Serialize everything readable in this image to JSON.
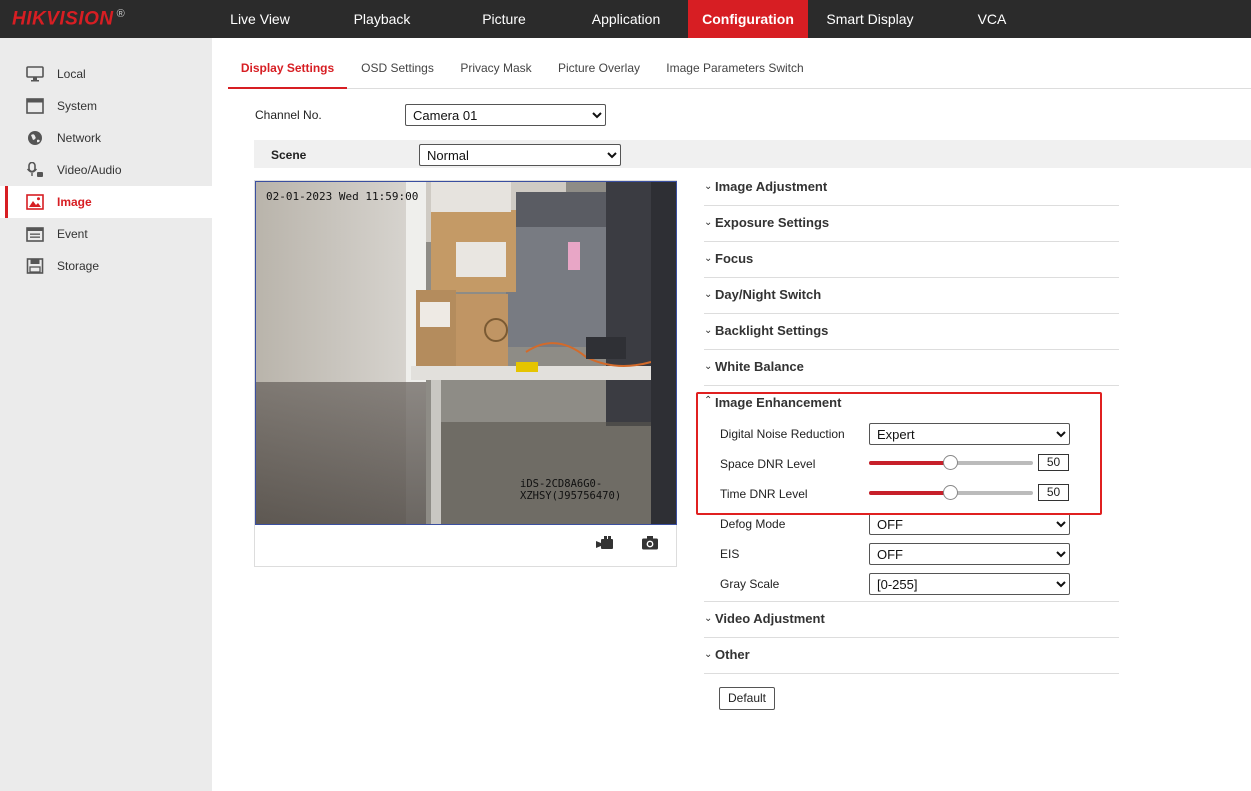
{
  "brand": {
    "name": "HIKVISION",
    "mark": "®",
    "accent": "#d71e23"
  },
  "nav": [
    "Live View",
    "Playback",
    "Picture",
    "Application",
    "Configuration",
    "Smart Display",
    "VCA"
  ],
  "sidebar": [
    {
      "label": "Local",
      "icon": "monitor-icon"
    },
    {
      "label": "System",
      "icon": "window-icon"
    },
    {
      "label": "Network",
      "icon": "globe-icon"
    },
    {
      "label": "Video/Audio",
      "icon": "microphone-icon"
    },
    {
      "label": "Image",
      "icon": "image-icon"
    },
    {
      "label": "Event",
      "icon": "calendar-icon"
    },
    {
      "label": "Storage",
      "icon": "disk-icon"
    }
  ],
  "tabs": [
    "Display Settings",
    "OSD Settings",
    "Privacy Mask",
    "Picture Overlay",
    "Image Parameters Switch"
  ],
  "channel": {
    "label": "Channel No.",
    "value": "Camera 01"
  },
  "scene": {
    "label": "Scene",
    "value": "Normal"
  },
  "video": {
    "timestamp": "02-01-2023 Wed 11:59:00",
    "camera_name": "iDS-2CD8A6G0-XZHSY(J95756470)"
  },
  "sections_top": [
    "Image Adjustment",
    "Exposure Settings",
    "Focus",
    "Day/Night Switch",
    "Backlight Settings",
    "White Balance"
  ],
  "enhancement": {
    "title": "Image Enhancement",
    "dnr_label": "Digital Noise Reduction",
    "dnr_value": "Expert",
    "space_label": "Space DNR Level",
    "space_value": "50",
    "space_fraction": 0.5,
    "time_label": "Time DNR Level",
    "time_value": "50",
    "time_fraction": 0.5,
    "defog_label": "Defog Mode",
    "defog_value": "OFF",
    "eis_label": "EIS",
    "eis_value": "OFF",
    "gray_label": "Gray Scale",
    "gray_value": "[0-255]"
  },
  "sections_bottom": [
    "Video Adjustment",
    "Other"
  ],
  "default_button": "Default"
}
